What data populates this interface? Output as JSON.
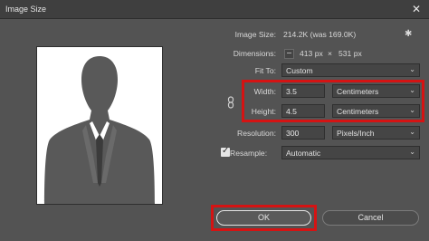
{
  "window": {
    "title": "Image Size",
    "close_glyph": "✕"
  },
  "info": {
    "image_size_label": "Image Size:",
    "image_size_value": "214.2K (was 169.0K)",
    "dimensions_label": "Dimensions:",
    "dim_width": "413 px",
    "dim_sep": "×",
    "dim_height": "531 px"
  },
  "fit_to": {
    "label": "Fit To:",
    "value": "Custom"
  },
  "width": {
    "label": "Width:",
    "value": "3.5",
    "unit": "Centimeters"
  },
  "height": {
    "label": "Height:",
    "value": "4.5",
    "unit": "Centimeters"
  },
  "resolution": {
    "label": "Resolution:",
    "value": "300",
    "unit": "Pixels/Inch"
  },
  "resample": {
    "label": "Resample:",
    "value": "Automatic",
    "checked": true
  },
  "buttons": {
    "ok": "OK",
    "cancel": "Cancel"
  },
  "icons": {
    "gear": "gear-icon",
    "link": "link-chain-icon",
    "chevron": "chevron-down-icon",
    "close": "close-icon"
  },
  "colors": {
    "highlight": "#d51313",
    "background": "#535353",
    "titlebar": "#3f3f3f"
  }
}
